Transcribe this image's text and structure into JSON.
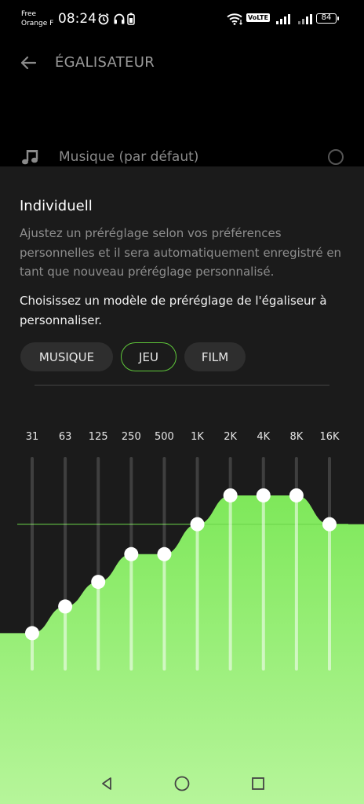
{
  "status_bar": {
    "carrier_line1": "Free",
    "carrier_line2": "Orange F",
    "time": "08:24",
    "volte": "VoLTE",
    "battery": "84"
  },
  "app_bar": {
    "title": "ÉGALISATEUR"
  },
  "background_preset": {
    "label": "Musique (par défaut)"
  },
  "sheet": {
    "title": "Individuell",
    "description": "Ajustez un préréglage selon vos préférences personnelles et il sera automatiquement enregistré en tant que nouveau préréglage personnalisé.",
    "prompt": "Choisissez un modèle de préréglage de l'égaliseur à personnaliser.",
    "chips": [
      {
        "label": "MUSIQUE",
        "selected": false
      },
      {
        "label": "JEU",
        "selected": true
      },
      {
        "label": "FILM",
        "selected": false
      }
    ]
  },
  "equalizer": {
    "bands": [
      "31",
      "63",
      "125",
      "250",
      "500",
      "1K",
      "2K",
      "4K",
      "8K",
      "16K"
    ],
    "levels": [
      0.175,
      0.3,
      0.415,
      0.545,
      0.545,
      0.685,
      0.82,
      0.82,
      0.82,
      0.685
    ],
    "fill_color_top": "#7ee85a",
    "fill_color_bottom": "#b6f59a",
    "line_color": "#6bd44a"
  },
  "nav_bar": {
    "icons": [
      "back-triangle-icon",
      "home-circle-icon",
      "recents-square-icon"
    ]
  }
}
